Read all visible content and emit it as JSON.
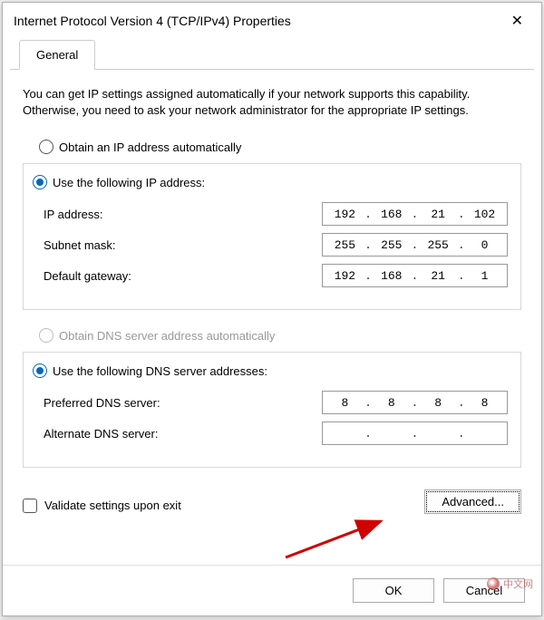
{
  "window": {
    "title": "Internet Protocol Version 4 (TCP/IPv4) Properties",
    "close_icon": "✕"
  },
  "tabs": {
    "general": "General"
  },
  "intro_text": "You can get IP settings assigned automatically if your network supports this capability. Otherwise, you need to ask your network administrator for the appropriate IP settings.",
  "ip_section": {
    "auto_label": "Obtain an IP address automatically",
    "manual_label": "Use the following IP address:",
    "fields": {
      "ip_label": "IP address:",
      "ip_value": [
        "192",
        "168",
        "21",
        "102"
      ],
      "subnet_label": "Subnet mask:",
      "subnet_value": [
        "255",
        "255",
        "255",
        "0"
      ],
      "gateway_label": "Default gateway:",
      "gateway_value": [
        "192",
        "168",
        "21",
        "1"
      ]
    }
  },
  "dns_section": {
    "auto_label": "Obtain DNS server address automatically",
    "manual_label": "Use the following DNS server addresses:",
    "fields": {
      "preferred_label": "Preferred DNS server:",
      "preferred_value": [
        "8",
        "8",
        "8",
        "8"
      ],
      "alternate_label": "Alternate DNS server:",
      "alternate_value": [
        "",
        "",
        "",
        ""
      ]
    }
  },
  "validate_label": "Validate settings upon exit",
  "buttons": {
    "advanced": "Advanced...",
    "ok": "OK",
    "cancel": "Cancel"
  },
  "watermark": "中文网"
}
